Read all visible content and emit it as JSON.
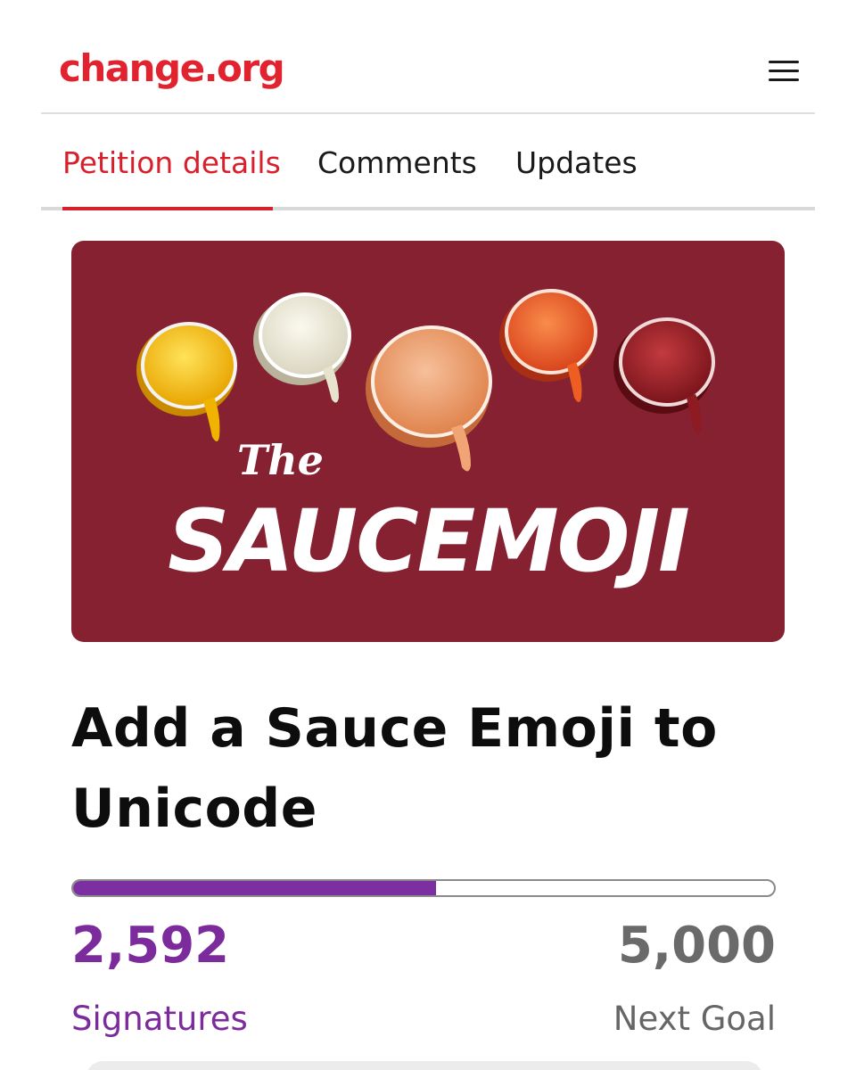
{
  "header": {
    "logo_text": "change.org",
    "menu_icon": "hamburger-menu-icon"
  },
  "tabs": [
    {
      "label": "Petition details",
      "active": true
    },
    {
      "label": "Comments",
      "active": false
    },
    {
      "label": "Updates",
      "active": false
    }
  ],
  "banner": {
    "title_small": "The",
    "title_large": "SAUCEMOJI",
    "background_color": "#862131",
    "sauce_colors": [
      "#f7c21a",
      "#eeeadb",
      "#f0a274",
      "#ef6a2a",
      "#9c1f27"
    ]
  },
  "petition": {
    "title": "Add a Sauce Emoji to Unicode"
  },
  "progress": {
    "signatures": "2,592",
    "signatures_label": "Signatures",
    "goal": "5,000",
    "goal_label": "Next Goal",
    "fraction": 0.518
  },
  "colors": {
    "brand_red": "#e0232f",
    "signature_purple": "#7b2b9b",
    "progress_purple": "#7b2fa0"
  }
}
